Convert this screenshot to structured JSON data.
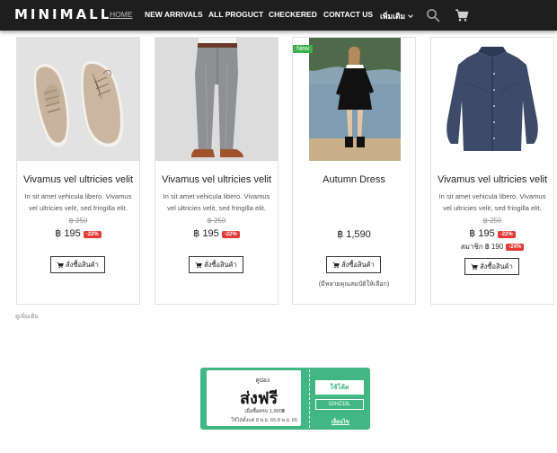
{
  "header": {
    "logo": "MINIMALL",
    "nav": [
      "HOME",
      "NEW ARRIVALS",
      "ALL PROGUCT",
      "CHECKERED",
      "CONTACT US",
      "เพิ่มเติม"
    ],
    "icons": [
      "search-icon",
      "cart-icon"
    ]
  },
  "products": [
    {
      "name": "Vivamus vel ultricies velit",
      "desc_line1": "In sit amet vehicula libero. Vivamus",
      "desc_line2": "vel ultricies velit, sed fringilla elit.",
      "old_price": "฿ 250",
      "price": "฿ 195",
      "discount": "-22%",
      "button": "สั่งซื้อสินค้า",
      "image": "beige-shoes"
    },
    {
      "name": "Vivamus vel ultricies velit",
      "desc_line1": "In sit amet vehicula libero. Vivamus",
      "desc_line2": "vel ultricies velit, sed fringilla elit.",
      "old_price": "฿ 250",
      "price": "฿ 195",
      "discount": "-22%",
      "button": "สั่งซื้อสินค้า",
      "image": "grey-trousers"
    },
    {
      "name": "Autumn Dress",
      "tag": "New",
      "price": "฿ 1,590",
      "button": "สั่งซื้อสินค้า",
      "note": "(มีหลายคุณสมบัติให้เลือก)",
      "image": "black-dress"
    },
    {
      "name": "Vivamus vel ultricies velit",
      "desc_line1": "In sit amet vehicula libero. Vivamus",
      "desc_line2": "vel ultricies velit, sed fringilla elit.",
      "old_price": "฿ 250",
      "price": "฿ 195",
      "discount": "-22%",
      "member_price": "สมาชิก ฿ 190",
      "member_discount": "-24%",
      "button": "สั่งซื้อสินค้า",
      "image": "navy-shirt"
    }
  ],
  "see_more": "ดูเพิ่มเติม",
  "coupon": {
    "label": "คูปอง",
    "title": "ส่งฟรี",
    "min_spend": "เมื่อซื้อครบ 1,000฿",
    "valid": "ใช้ได้ตั้งแต่ 8 พ.ย. 65-8 พ.ย. 65",
    "use_button": "ใช้โค้ด",
    "code": "02HZ33L",
    "conditions": "เงื่อนไข"
  },
  "colors": {
    "header_bg": "#1e1e1e",
    "badge": "#e53935",
    "new_tag": "#3cb04a",
    "coupon": "#41b883"
  }
}
